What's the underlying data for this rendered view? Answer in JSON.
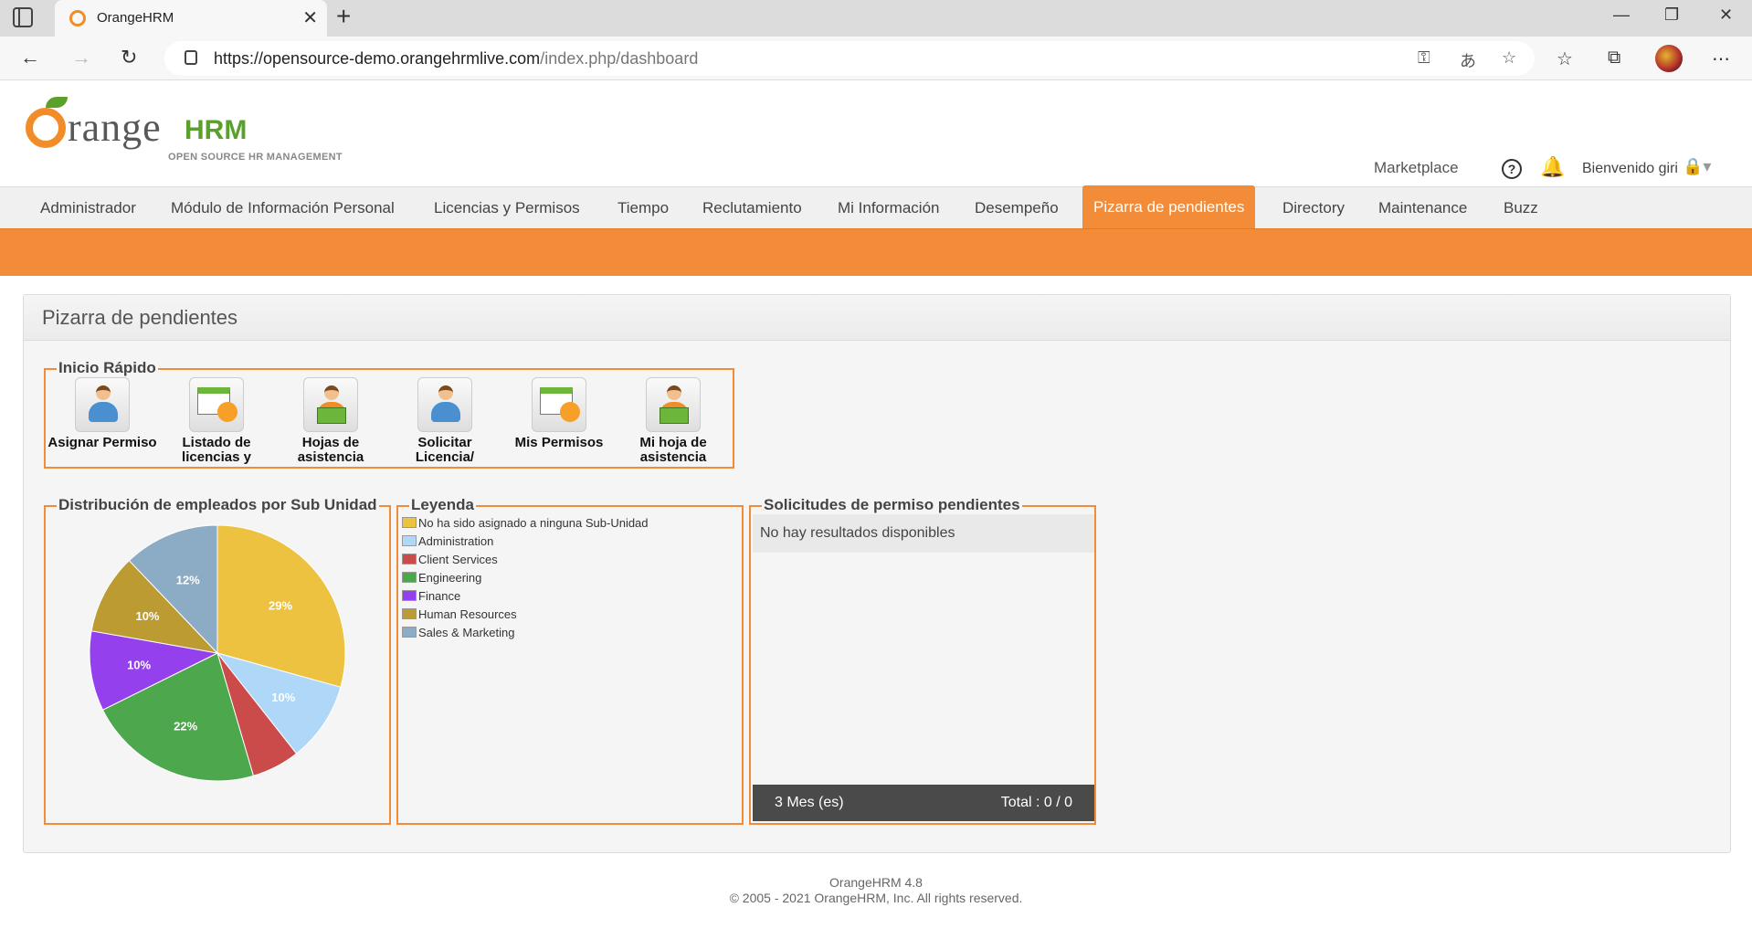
{
  "browser": {
    "tab_title": "OrangeHRM",
    "url_host": "https://opensource-demo.orangehrmlive.com",
    "url_path": "/index.php/dashboard"
  },
  "header": {
    "logo_text_orange": "Orange",
    "logo_text_hrm": "HRM",
    "logo_tagline": "OPEN SOURCE HR MANAGEMENT",
    "marketplace": "Marketplace",
    "welcome": "Bienvenido giri"
  },
  "menu": {
    "items": [
      {
        "label": "Administrador"
      },
      {
        "label": "Módulo de Información Personal"
      },
      {
        "label": "Licencias y Permisos"
      },
      {
        "label": "Tiempo"
      },
      {
        "label": "Reclutamiento"
      },
      {
        "label": "Mi Información"
      },
      {
        "label": "Desempeño"
      },
      {
        "label": "Pizarra de pendientes",
        "active": true
      },
      {
        "label": "Directory"
      },
      {
        "label": "Maintenance"
      },
      {
        "label": "Buzz"
      }
    ]
  },
  "dashboard": {
    "title": "Pizarra de pendientes",
    "quick_launch": {
      "title": "Inicio Rápido",
      "items": [
        {
          "label": "Asignar Permiso",
          "icon": "person-icon"
        },
        {
          "label": "Listado de licencias y",
          "icon": "calendar-icon"
        },
        {
          "label": "Hojas de asistencia",
          "icon": "reader-icon"
        },
        {
          "label": "Solicitar Licencia/",
          "icon": "person-icon"
        },
        {
          "label": "Mis Permisos",
          "icon": "calendar-icon"
        },
        {
          "label": "Mi hoja de asistencia",
          "icon": "reader-icon"
        }
      ]
    },
    "distribution": {
      "title": "Distribución de empleados por Sub Unidad"
    },
    "legend": {
      "title": "Leyenda",
      "items": [
        {
          "label": "No ha sido asignado a ninguna Sub-Unidad",
          "color": "#edc240"
        },
        {
          "label": "Administration",
          "color": "#afd8f8"
        },
        {
          "label": "Client Services",
          "color": "#cb4b4b"
        },
        {
          "label": "Engineering",
          "color": "#4da74d"
        },
        {
          "label": "Finance",
          "color": "#9440ed"
        },
        {
          "label": "Human Resources",
          "color": "#bd9b33"
        },
        {
          "label": "Sales & Marketing",
          "color": "#8cacc6"
        }
      ]
    },
    "leave_requests": {
      "title": "Solicitudes de permiso pendientes",
      "empty_text": "No hay resultados disponibles",
      "period": "3 Mes (es)",
      "total": "Total : 0 / 0"
    }
  },
  "chart_data": {
    "type": "pie",
    "categories": [
      "No ha sido asignado a ninguna Sub-Unidad",
      "Administration",
      "Client Services",
      "Engineering",
      "Finance",
      "Human Resources",
      "Sales & Marketing"
    ],
    "values": [
      29,
      10,
      6,
      22,
      10,
      10,
      12
    ],
    "labels": [
      "29%",
      "10%",
      "",
      "22%",
      "10%",
      "10%",
      "12%"
    ],
    "colors": [
      "#edc240",
      "#afd8f8",
      "#cb4b4b",
      "#4da74d",
      "#9440ed",
      "#bd9b33",
      "#8cacc6"
    ]
  },
  "footer": {
    "version": "OrangeHRM 4.8",
    "copyright": "© 2005 - 2021 OrangeHRM, Inc. All rights reserved."
  }
}
